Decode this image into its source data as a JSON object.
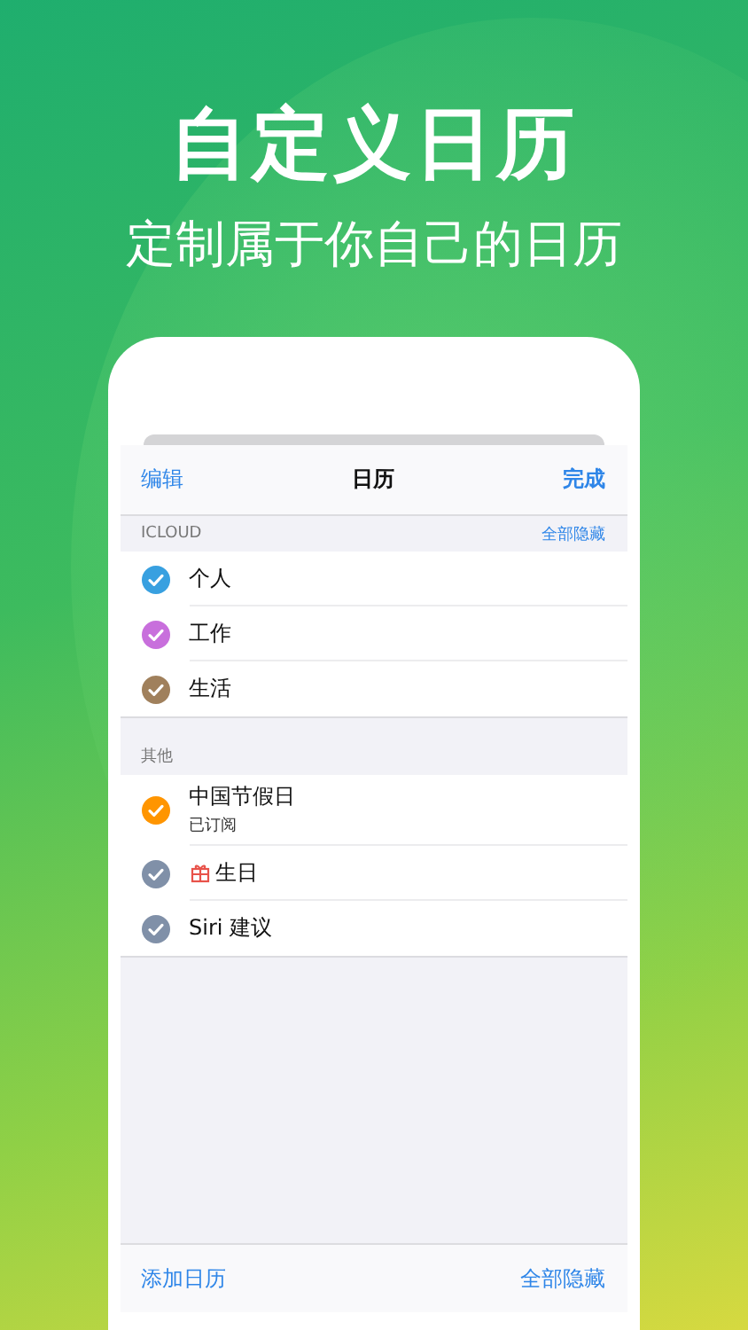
{
  "headline": "自定义日历",
  "subheadline": "定制属于你自己的日历",
  "nav": {
    "left": "编辑",
    "title": "日历",
    "right": "完成"
  },
  "sections": [
    {
      "header": "ICLOUD",
      "action": "全部隐藏",
      "items": [
        {
          "name": "个人",
          "checked": true,
          "color": "#38a0e0",
          "kind": "plain"
        },
        {
          "name": "工作",
          "checked": true,
          "color": "#c86fdc",
          "kind": "plain"
        },
        {
          "name": "生活",
          "checked": true,
          "color": "#a0805c",
          "kind": "plain"
        }
      ]
    },
    {
      "header": "其他",
      "items": [
        {
          "name": "中国节假日",
          "subtitle": "已订阅",
          "checked": true,
          "color": "#ff9500",
          "kind": "plain"
        },
        {
          "name": "生日",
          "checked": true,
          "color": "#8090a8",
          "kind": "gift"
        },
        {
          "name": "Siri 建议",
          "checked": true,
          "color": "#8090a8",
          "kind": "plain"
        }
      ]
    }
  ],
  "footer": {
    "left": "添加日历",
    "right": "全部隐藏"
  }
}
